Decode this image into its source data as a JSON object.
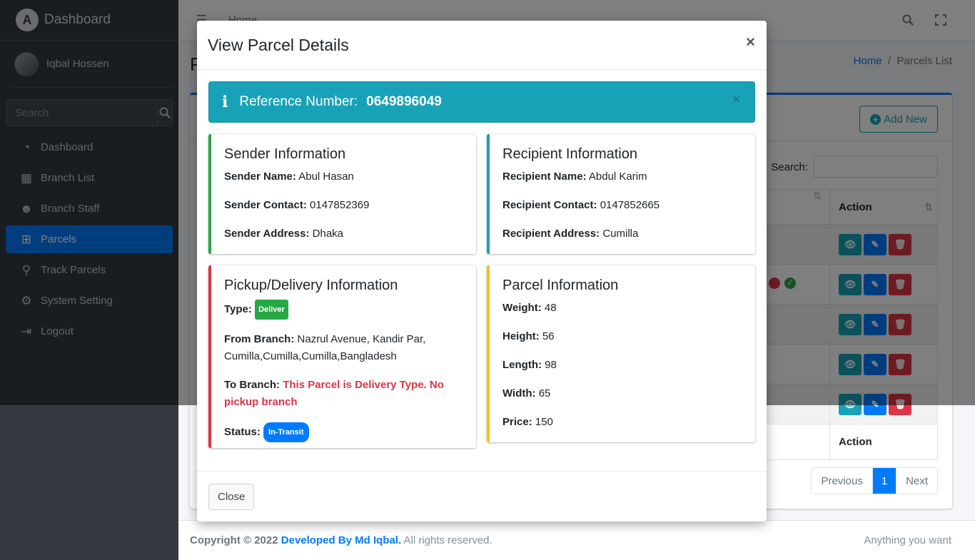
{
  "brand": {
    "logo_letter": "A",
    "title": "Dashboard"
  },
  "user": {
    "name": "Iqbal Hossen"
  },
  "sidebar_search": {
    "placeholder": "Search"
  },
  "nav": [
    {
      "label": "Dashboard",
      "icon": "tachometer-icon",
      "glyph": "◔"
    },
    {
      "label": "Branch List",
      "icon": "building-icon",
      "glyph": "▦"
    },
    {
      "label": "Branch Staff",
      "icon": "users-icon",
      "glyph": "👥"
    },
    {
      "label": "Parcels",
      "icon": "sitemap-icon",
      "glyph": "⊞"
    },
    {
      "label": "Track Parcels",
      "icon": "search-icon",
      "glyph": "⚲"
    },
    {
      "label": "System Setting",
      "icon": "gear-icon",
      "glyph": "⚙"
    },
    {
      "label": "Logout",
      "icon": "sign-out-icon",
      "glyph": "⇥"
    }
  ],
  "topbar": {
    "home_link": "Home"
  },
  "content": {
    "page_title_initial": "P",
    "breadcrumb_home": "Home",
    "breadcrumb_sep": "/",
    "breadcrumb_current": "Parcels List",
    "add_new_label": "Add New",
    "search_label": "Search:",
    "action_header": "Action",
    "action_footer": "Action"
  },
  "pagination": {
    "previous": "Previous",
    "page": "1",
    "next": "Next"
  },
  "footer": {
    "copyright": "Copyright © 2022",
    "developer": "Developed By Md Iqbal.",
    "rights": "All rights reserved.",
    "right_text": "Anything you want"
  },
  "modal": {
    "title": "View Parcel Details",
    "close_x": "×",
    "reference_label": "Reference Number:",
    "reference_value": "0649896049",
    "sender": {
      "heading": "Sender Information",
      "name_label": "Sender Name:",
      "name": "Abul Hasan",
      "contact_label": "Sender Contact:",
      "contact": "0147852369",
      "address_label": "Sender Address:",
      "address": "Dhaka"
    },
    "recipient": {
      "heading": "Recipient Information",
      "name_label": "Recipient Name:",
      "name": "Abdul Karim",
      "contact_label": "Recipient Contact:",
      "contact": "0147852665",
      "address_label": "Recipient Address:",
      "address": "Cumilla"
    },
    "pickup": {
      "heading": "Pickup/Delivery Information",
      "type_label": "Type:",
      "type_badge": "Deliver",
      "from_label": "From Branch:",
      "from_value": "Nazrul Avenue, Kandir Par, Cumilla,Cumilla,Cumilla,Bangladesh",
      "to_label": "To Branch:",
      "to_value": "This Parcel is Delivery Type. No pickup branch",
      "status_label": "Status:",
      "status_badge": "In-Transit"
    },
    "parcel": {
      "heading": "Parcel Information",
      "weight_label": "Weight:",
      "weight": "48",
      "height_label": "Height:",
      "height": "56",
      "length_label": "Length:",
      "length": "98",
      "width_label": "Width:",
      "width": "65",
      "price_label": "Price:",
      "price": "150"
    },
    "close_button": "Close"
  },
  "colors": {
    "sidebar_bg": "#343a40",
    "primary": "#007bff",
    "info": "#17a2b8",
    "success": "#28a745",
    "danger": "#dc3545",
    "warning": "#ffc107"
  }
}
